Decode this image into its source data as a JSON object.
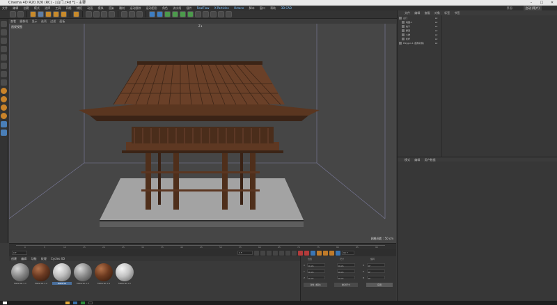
{
  "window": {
    "title": "Cinema 4D R20.026 (RC) - [山门.c4d *] - 主要",
    "minimize": "–",
    "maximize": "□",
    "close": "✕"
  },
  "menu": [
    "文件",
    "编辑",
    "创建",
    "模式",
    "选择",
    "工具",
    "网格",
    "捕捉",
    "动画",
    "模拟",
    "渲染",
    "雕刻",
    "运动跟踪",
    "运动图形",
    "角色",
    "流水线",
    "插件",
    "RealFlow",
    "X-Particles",
    "Octane",
    "脚本",
    "窗口",
    "帮助",
    "3D CAD"
  ],
  "menu_highlighted": [
    "RealFlow",
    "X-Particles",
    "Octane",
    "3D CAD"
  ],
  "layout": {
    "label": "界面:",
    "value": "启动 (用户)"
  },
  "viewport": {
    "menu": [
      "查看",
      "摄像机",
      "显示",
      "选项",
      "过滤",
      "面板"
    ],
    "view_name": "透视视图",
    "top_marker": "Z↓",
    "grid_info": "网格间距 : 50 cm"
  },
  "timeline": {
    "ticks": [
      "0",
      "5",
      "10",
      "15",
      "20",
      "25",
      "30",
      "35",
      "40",
      "45",
      "50",
      "55",
      "60",
      "65",
      "70",
      "75",
      "80",
      "85",
      "90"
    ],
    "start": "0 F",
    "current": "0 F",
    "end": "90 F",
    "frame_display": "0 F"
  },
  "materials": {
    "menu": [
      "创建",
      "编辑",
      "功能",
      "纹理",
      "Cycles 4D"
    ],
    "items": [
      {
        "name": "Material.1.1",
        "color": "#8a8a8a",
        "selected": false
      },
      {
        "name": "Material.1.2",
        "color": "#6b3a22",
        "selected": false
      },
      {
        "name": "Material",
        "color": "#bdbdbd",
        "selected": true
      },
      {
        "name": "Material.1.3",
        "color": "#8e8e8e",
        "selected": false
      },
      {
        "name": "Material.1.4",
        "color": "#6e3b20",
        "selected": false
      },
      {
        "name": "Material.1.5",
        "color": "#c4c4c4",
        "selected": false
      }
    ]
  },
  "coordinates": {
    "headers": [
      "位置",
      "尺寸",
      "旋转"
    ],
    "rows": [
      {
        "axis": "X",
        "pos": "0 cm",
        "size": "0 cm",
        "rot_label": "H",
        "rot": "0°"
      },
      {
        "axis": "Y",
        "pos": "0 cm",
        "size": "0 cm",
        "rot_label": "P",
        "rot": "0°"
      },
      {
        "axis": "Z",
        "pos": "0 cm",
        "size": "0 cm",
        "rot_label": "B",
        "rot": "0°"
      }
    ],
    "mode1": "对象 (相对)",
    "mode2": "绝对尺寸",
    "apply": "应用"
  },
  "objects": {
    "menu": [
      "文件",
      "编辑",
      "查看",
      "对象",
      "标签",
      "书签"
    ],
    "items": [
      "山门",
      "地面.1",
      "柱子",
      "屋顶",
      "斗拱",
      "栏杆",
      "Polygon.1 (结构对象)"
    ]
  },
  "attributes": {
    "menu": [
      "模式",
      "编辑",
      "用户数据"
    ]
  },
  "colors": {
    "wood": "#5b3621",
    "wood_dark": "#3b2416",
    "ground": "#9a9a9a",
    "viewport_bg": "#464646",
    "accent": "#3e7ec2"
  }
}
